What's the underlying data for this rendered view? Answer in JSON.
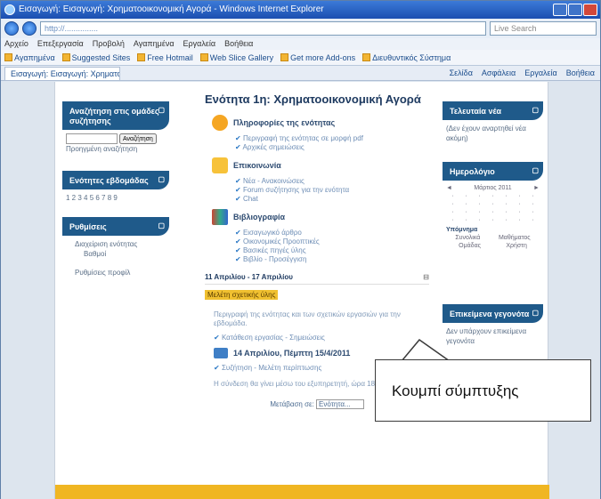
{
  "window": {
    "title": "Εισαγωγή: Εισαγωγή: Χρηματοοικονομική Αγορά - Windows Internet Explorer",
    "address": "http://...............",
    "search_placeholder": "Live Search",
    "menu": [
      "Αρχείο",
      "Επεξεργασία",
      "Προβολή",
      "Αγαπημένα",
      "Εργαλεία",
      "Βοήθεια"
    ],
    "favorites": [
      "Αγαπημένα",
      "Suggested Sites",
      "Free Hotmail",
      "Web Slice Gallery",
      "Get more Add-ons",
      "Διευθυντικός Σύστημα"
    ],
    "tab_label": "Εισαγωγή: Εισαγωγή: Χρηματοοικονομική Αγορά",
    "tab_tools": [
      "Σελίδα",
      "Ασφάλεια",
      "Εργαλεία",
      "Βοήθεια"
    ]
  },
  "left_blocks": {
    "search": {
      "title": "Αναζήτηση στις ομάδες συζήτησης",
      "button": "Αναζήτηση",
      "advanced": "Προηγμένη αναζήτηση"
    },
    "topics": {
      "title": "Ενότητες εβδομάδας",
      "numbers": "1 2 3 4 5 6 7 8 9"
    },
    "settings": {
      "title": "Ρυθμίσεις",
      "items": [
        "Διαχείριση ενότητας",
        "Βαθμοί",
        "Ρυθμίσεις προφίλ"
      ]
    }
  },
  "center": {
    "title": "Ενότητα 1η: Χρηματοοικονομική Αγορά",
    "sections": [
      {
        "heading": "Πληροφορίες της ενότητας",
        "items": [
          "Περιγραφή της ενότητας σε μορφή pdf",
          "Αρχικές σημειώσεις"
        ]
      },
      {
        "heading": "Επικοινωνία",
        "items": [
          "Νέα - Ανακοινώσεις",
          "Forum συζήτησης για την ενότητα",
          "Chat"
        ]
      },
      {
        "heading": "Βιβλιογραφία",
        "items": [
          "Εισαγωγικό άρθρο",
          "Οικονομικές Προοπτικές",
          "Βασικές πηγές ύλης",
          "Βιβλίο - Προσέγγιση"
        ]
      }
    ],
    "week": "11 Απριλίου - 17 Απριλίου",
    "week_highlight": "Μελέτη σχετικής ύλης",
    "week_para": "Περιγραφή της ενότητας και των σχετικών εργασιών για την εβδομάδα.",
    "week_link": "Κατάθεση εργασίας - Σημειώσεις",
    "meeting": "14 Απριλίου, Πέμπτη 15/4/2011",
    "forum_line": "Συζήτηση - Μελέτη περίπτωσης",
    "footer_para": "Η σύνδεση θα γίνει μέσω του εξυπηρετητή, ώρα 18:00.",
    "jump_label": "Μετάβαση σε:",
    "jump_value": "Ενότητα..."
  },
  "right_blocks": {
    "recent": {
      "title": "Τελευταία νέα",
      "body": "(Δεν έχουν αναρτηθεί νέα ακόμη)"
    },
    "calendar": {
      "title": "Ημερολόγιο",
      "month": "Μάρτιος 2011",
      "legend_title": "Υπόμνημα",
      "legend": [
        "Συνολικά",
        "Μαθήματος",
        "Ομάδας",
        "Χρήστη"
      ]
    },
    "upcoming": {
      "title": "Επικείμενα γεγονότα",
      "body": "Δεν υπάρχουν επικείμενα γεγονότα"
    }
  },
  "callout": {
    "text": "Κουμπί σύμπτυξης"
  },
  "colors": {
    "block_head": "#1f5a8a",
    "highlight": "#f0c030",
    "footer": "#f0b622"
  }
}
